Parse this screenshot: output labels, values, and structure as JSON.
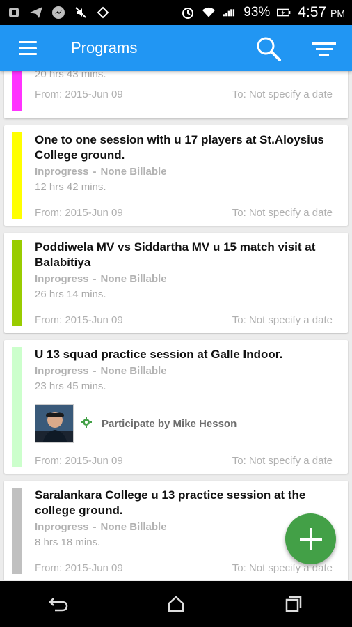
{
  "status_bar": {
    "battery": "93%",
    "time": "4:57",
    "ampm": "PM",
    "icons": [
      "notification-icon",
      "send-icon",
      "messenger-icon",
      "mute-icon",
      "vpn-icon",
      "alarm-icon",
      "wifi-icon",
      "signal-icon",
      "battery-icon"
    ]
  },
  "app_bar": {
    "title": "Programs",
    "icons": {
      "menu": "menu-icon",
      "search": "search-icon",
      "filter": "filter-icon"
    }
  },
  "programs": [
    {
      "title": "",
      "status": "",
      "billing": "",
      "duration": "20 hrs 43 mins.",
      "from": "From: 2015-Jun 09",
      "to": "To: Not specify a date",
      "color": "#ff33ff"
    },
    {
      "title": "One to one session with u 17 players at St.Aloysius College ground.",
      "status": "Inprogress",
      "billing": "None Billable",
      "duration": "12 hrs 42 mins.",
      "from": "From: 2015-Jun 09",
      "to": "To: Not specify a date",
      "color": "#ffff00"
    },
    {
      "title": "Poddiwela MV vs Siddartha MV u 15 match visit at Balabitiya",
      "status": "Inprogress",
      "billing": "None Billable",
      "duration": "26 hrs 14 mins.",
      "from": "From: 2015-Jun 09",
      "to": "To: Not specify a date",
      "color": "#99cc00"
    },
    {
      "title": "U 13 squad practice session at Galle Indoor.",
      "status": "Inprogress",
      "billing": "None Billable",
      "duration": "23 hrs 45 mins.",
      "participant": "Participate by Mike Hesson",
      "from": "From: 2015-Jun 09",
      "to": "To: Not specify a date",
      "color": "#ccffcc"
    },
    {
      "title": "Saralankara College u 13 practice session at the college ground.",
      "status": "Inprogress",
      "billing": "None Billable",
      "duration": "8 hrs 18 mins.",
      "from": "From: 2015-Jun 09",
      "to": "To: Not specify a date",
      "color": "#c0c0c0"
    }
  ],
  "fab": {
    "icon": "add-icon"
  },
  "nav_bar": {
    "icons": [
      "back-icon",
      "home-icon",
      "recents-icon"
    ]
  },
  "colors": {
    "primary": "#2196f3",
    "fab": "#43a047"
  }
}
